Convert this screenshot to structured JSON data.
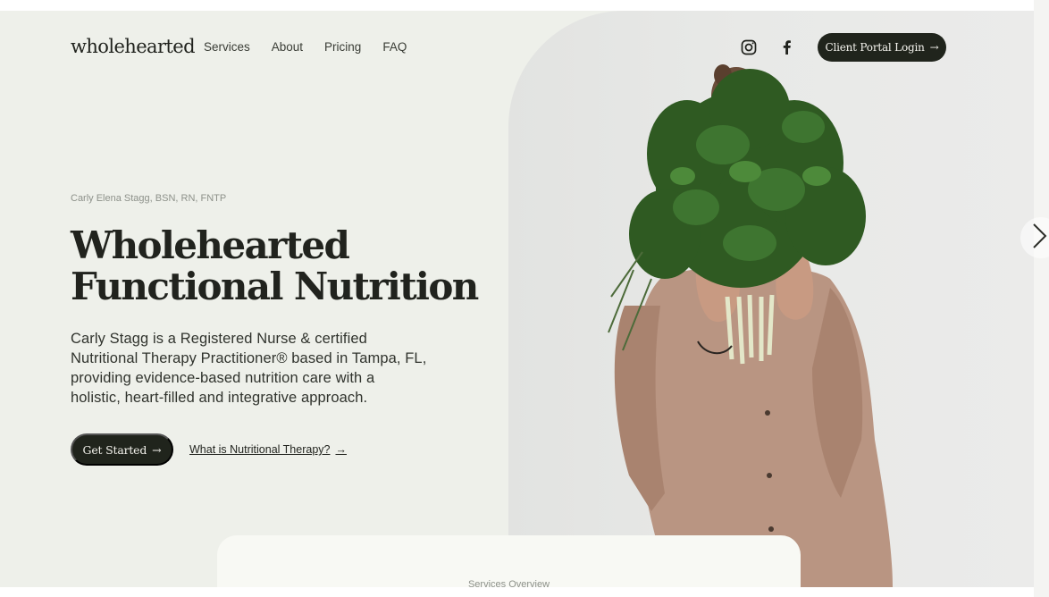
{
  "header": {
    "logo": "wholehearted",
    "nav": [
      "Services",
      "About",
      "Pricing",
      "FAQ"
    ],
    "portal_label": "Client Portal Login",
    "social_icons": [
      "instagram-icon",
      "facebook-icon"
    ]
  },
  "hero": {
    "credentials": "Carly Elena Stagg, BSN, RN, FNTP",
    "headline_line1": "Wholehearted",
    "headline_line2": "Functional Nutrition",
    "description": "Carly Stagg is a Registered Nurse & certified Nutritional Therapy Practitioner® based in Tampa, FL, providing evidence-based nutrition care with a holistic, heart-filled and integrative approach.",
    "cta_primary": "Get Started",
    "cta_secondary": "What is Nutritional Therapy?",
    "arrow": "→"
  },
  "card": {
    "label": "Services Overview"
  },
  "colors": {
    "background": "#eef0ea",
    "dark_button": "#20241c",
    "card": "#f8f9f4"
  }
}
